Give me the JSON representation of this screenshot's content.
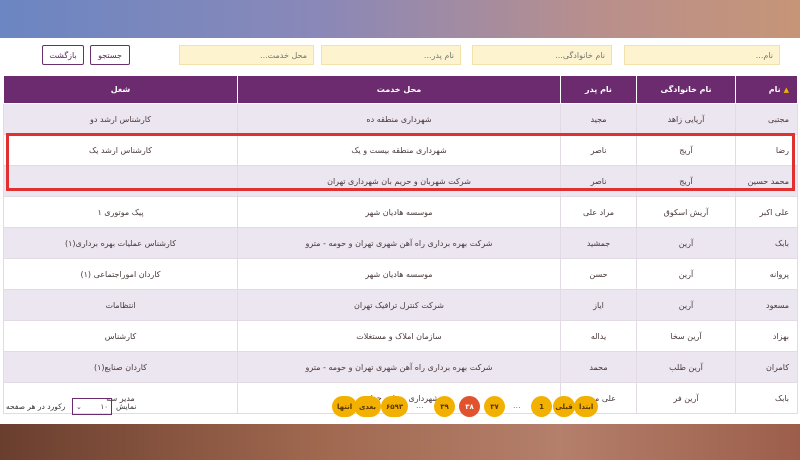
{
  "search": {
    "first_name_placeholder": "نام...",
    "last_name_placeholder": "نام خانوادگی...",
    "father_name_placeholder": "نام پدر...",
    "workplace_placeholder": "محل خدمت...",
    "search_label": "جستجو",
    "back_label": "بازگشت"
  },
  "table": {
    "headers": {
      "first_name": "نام",
      "last_name": "نام خانوادگی",
      "father_name": "نام پدر",
      "workplace": "محل خدمت",
      "job": "شغل"
    },
    "rows": [
      {
        "first_name": "مجتبی",
        "last_name": "آریایی زاهد",
        "father_name": "مجید",
        "workplace": "شهرداری منطقه ده",
        "job": "کارشناس ارشد دو"
      },
      {
        "first_name": "رضا",
        "last_name": "آریج",
        "father_name": "ناصر",
        "workplace": "شهرداری منطقه بیست و یک",
        "job": "کارشناس ارشد یک"
      },
      {
        "first_name": "محمد حسین",
        "last_name": "آریج",
        "father_name": "ناصر",
        "workplace": "شرکت شهربان و حریم بان شهرداری تهران",
        "job": ""
      },
      {
        "first_name": "علی اکبر",
        "last_name": "آریش اسکوق",
        "father_name": "مراد علی",
        "workplace": "موسسه هادیان شهر",
        "job": "پیک موتوری ۱"
      },
      {
        "first_name": "بابک",
        "last_name": "آرین",
        "father_name": "جمشید",
        "workplace": "شرکت بهره برداری راه آهن شهری تهران و حومه - مترو",
        "job": "کارشناس عملیات بهره برداری(۱)"
      },
      {
        "first_name": "پروانه",
        "last_name": "آرین",
        "father_name": "حسن",
        "workplace": "موسسه هادیان شهر",
        "job": "کاردان اموراجتماعی (۱)"
      },
      {
        "first_name": "مسعود",
        "last_name": "آرین",
        "father_name": "ایاز",
        "workplace": "شرکت کنترل ترافیک تهران",
        "job": "انتظامات"
      },
      {
        "first_name": "بهزاد",
        "last_name": "آرین سخا",
        "father_name": "یداله",
        "workplace": "سازمان املاک و مستغلات",
        "job": "کارشناس"
      },
      {
        "first_name": "کامران",
        "last_name": "آرین طلب",
        "father_name": "محمد",
        "workplace": "شرکت بهره برداری راه آهن شهری تهران و حومه - مترو",
        "job": "کاردان صنایع(۱)"
      },
      {
        "first_name": "بابک",
        "last_name": "آرین فر",
        "father_name": "علی محمد",
        "workplace": "شهرداری منطقه چهارده",
        "job": "مدیر سه"
      }
    ]
  },
  "pagination": {
    "first_label": "ابتدا",
    "prev_label": "قبلی",
    "page_1": "1",
    "ellipsis": "...",
    "page_37": "۳۷",
    "page_38": "۳۸",
    "page_39": "۳۹",
    "page_last": "۶۵۹۳",
    "next_label": "بعدی",
    "last_label": "انتها"
  },
  "footer": {
    "show_label": "نمایش",
    "per_page_value": "۱۰",
    "records_label": "رکورد در هر صفحه"
  },
  "colors": {
    "header_bg": "#6b2b6e",
    "highlight_border": "#e03030",
    "pager_button": "#f2b000",
    "pager_active": "#e0532e",
    "search_field_bg": "#fdf3cf"
  }
}
